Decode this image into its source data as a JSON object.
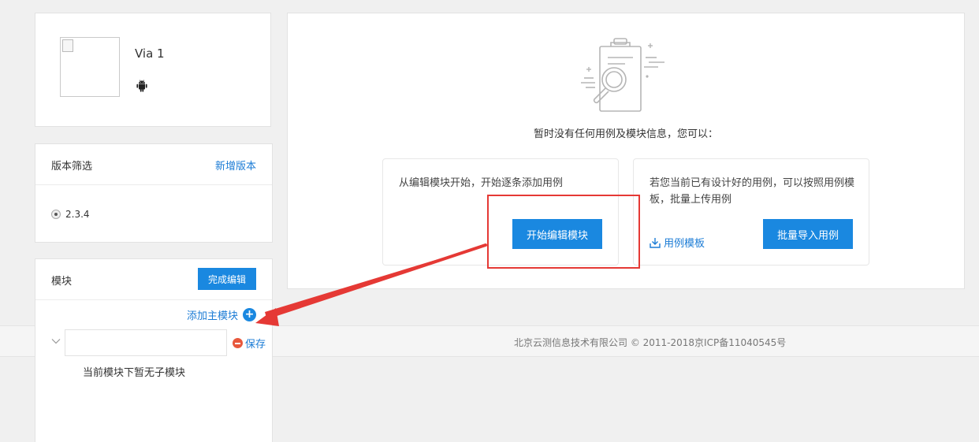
{
  "app": {
    "name": "Via 1",
    "platform_icon": "android-icon"
  },
  "version_panel": {
    "title": "版本筛选",
    "add_version_label": "新增版本",
    "versions": [
      {
        "label": "2.3.4",
        "selected": true
      }
    ]
  },
  "module_panel": {
    "title": "模块",
    "finish_edit_label": "完成编辑",
    "add_main_module_label": "添加主模块",
    "new_module_input": {
      "value": "",
      "placeholder": ""
    },
    "save_label": "保存",
    "no_submodule_text": "当前模块下暂无子模块"
  },
  "empty_state": {
    "illustration_icon": "clipboard-search-icon",
    "message": "暂时没有任何用例及模块信息，您可以：",
    "options": [
      {
        "description": "从编辑模块开始，开始逐条添加用例",
        "button_label": "开始编辑模块"
      },
      {
        "description": "若您当前已有设计好的用例，可以按照用例模 板，批量上传用例",
        "link_label": "用例模板",
        "link_icon": "download-icon",
        "button_label": "批量导入用例"
      }
    ]
  },
  "footer": {
    "copyright": "北京云测信息技术有限公司 © 2011-2018京ICP备11040545号"
  },
  "colors": {
    "primary": "#1a88e0",
    "link": "#1a7bd5",
    "danger": "#e8583c",
    "annotation_red": "#e53935"
  }
}
